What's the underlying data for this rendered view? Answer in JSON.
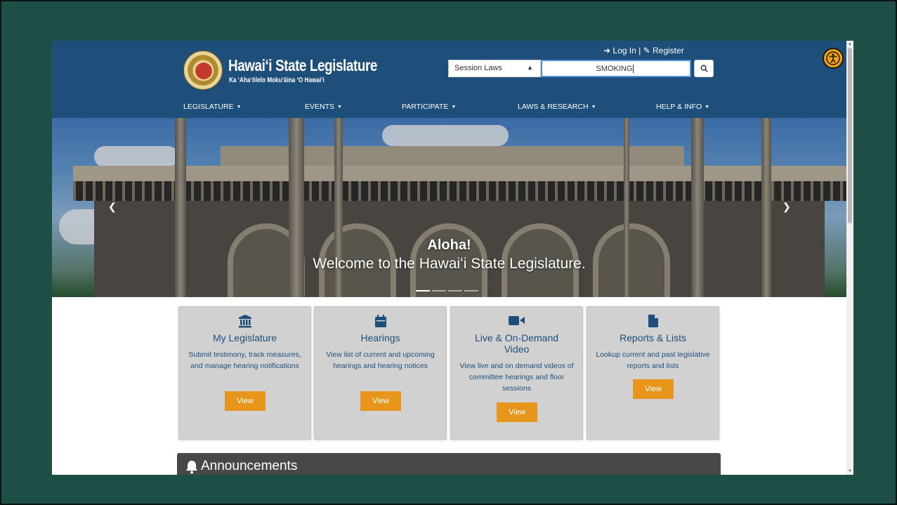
{
  "header": {
    "site_title": "Hawaiʻi State Legislature",
    "site_subtitle": "Ka ʻAhaʻōlelo Mokuʻāina ʻO Hawaiʻi",
    "login_label": "Log In",
    "separator": "|",
    "register_label": "Register",
    "search": {
      "scope_value": "Session Laws",
      "query_value": "SMOKING"
    }
  },
  "nav": {
    "items": [
      {
        "label": "LEGISLATURE"
      },
      {
        "label": "EVENTS"
      },
      {
        "label": "PARTICIPATE"
      },
      {
        "label": "LAWS & RESEARCH"
      },
      {
        "label": "HELP & INFO"
      }
    ]
  },
  "hero": {
    "title": "Aloha!",
    "subtitle": "Welcome to the Hawaiʻi State Legislature.",
    "slide_count": 4,
    "active_slide": 1
  },
  "cards": [
    {
      "icon": "landmark-icon",
      "title": "My Legislature",
      "description": "Submit testimony, track measures, and manage hearing notifications",
      "button": "View"
    },
    {
      "icon": "calendar-icon",
      "title": "Hearings",
      "description": "View list of current and upcoming hearings and hearing notices",
      "button": "View"
    },
    {
      "icon": "video-icon",
      "title": "Live & On-Demand Video",
      "description": "View live and on demand videos of committee hearings and floor sessions",
      "button": "View"
    },
    {
      "icon": "file-icon",
      "title": "Reports & Lists",
      "description": "Lookup current and past legislative reports and lists",
      "button": "View"
    }
  ],
  "announcements": {
    "title": "Announcements"
  },
  "colors": {
    "header_bg": "#1e4f7a",
    "accent_orange": "#e8951c",
    "card_bg": "#d1d1d1",
    "announce_bg": "#484848",
    "outer_bg": "#1d4f47"
  }
}
